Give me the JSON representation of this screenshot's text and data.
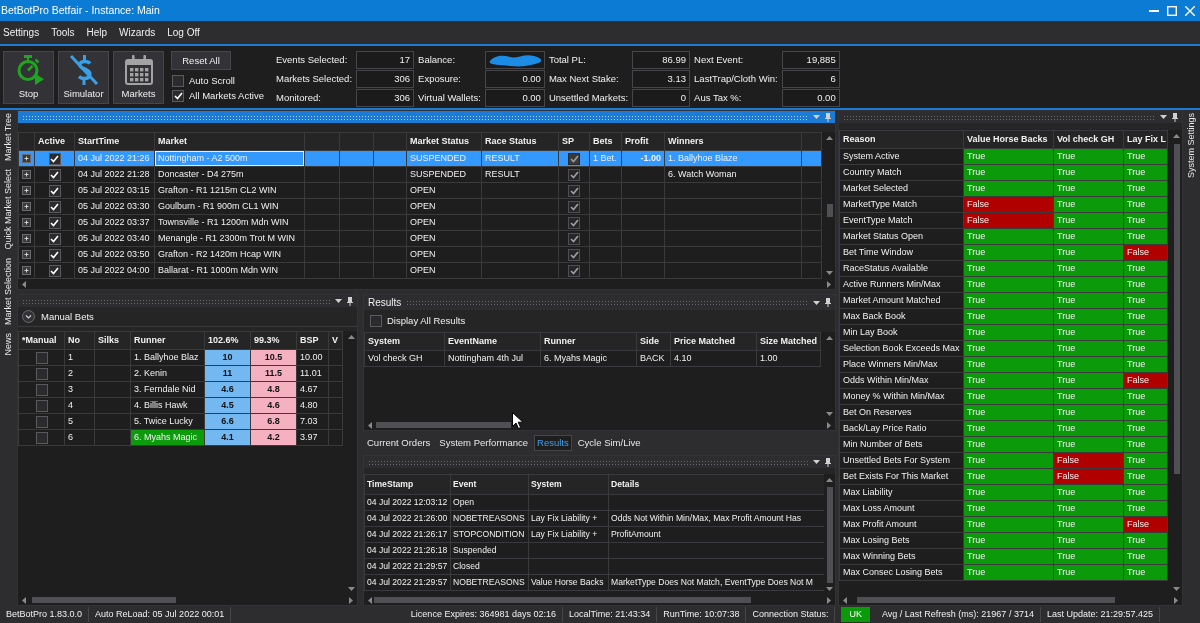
{
  "window": {
    "title": "BetBotPro Betfair - Instance: Main"
  },
  "menu": [
    "Settings",
    "Tools",
    "Help",
    "Wizards",
    "Log Off"
  ],
  "toolbar": {
    "buttons": [
      {
        "kind": "stop",
        "label": "Stop"
      },
      {
        "kind": "simulator",
        "label": "Simulator"
      },
      {
        "kind": "markets",
        "label": "Markets"
      }
    ],
    "reset_button": "Reset All",
    "options": [
      {
        "label": "Auto Scroll",
        "checked": false
      },
      {
        "label": "All Markets Active",
        "checked": true
      }
    ],
    "stats": [
      {
        "label": "Events Selected:",
        "value": "17",
        "redacted": false
      },
      {
        "label": "Balance:",
        "redacted": true
      },
      {
        "label": "Total PL:",
        "value": "86.99",
        "redacted": false
      },
      {
        "label": "Next Event:",
        "value": "19,885",
        "redacted": false
      },
      {
        "label": "Markets Selected:",
        "value": "306",
        "redacted": false
      },
      {
        "label": "Exposure:",
        "value": "0.00",
        "redacted": false
      },
      {
        "label": "Max Next Stake:",
        "value": "3.13",
        "redacted": false
      },
      {
        "label": "LastTrap/Cloth Win:",
        "value": "6",
        "redacted": false
      },
      {
        "label": "Monitored:",
        "value": "306",
        "redacted": false
      },
      {
        "label": "Virtual Wallets:",
        "value": "0.00",
        "redacted": false
      },
      {
        "label": "Unsettled Markets:",
        "value": "0",
        "redacted": false
      },
      {
        "label": "Aus Tax %:",
        "value": "0.00",
        "redacted": false
      }
    ]
  },
  "side_tabs": {
    "left": [
      "Market Tree",
      "Quick Market Select",
      "Market Selection",
      "News"
    ],
    "right": [
      "System Settings"
    ]
  },
  "markets": {
    "focused": true,
    "columns": [
      "Active",
      "StartTime",
      "Market",
      "Market Status",
      "Race Status",
      "SP",
      "Bets",
      "Profit",
      "Winners"
    ],
    "rows": [
      {
        "selected": true,
        "active": true,
        "start": "04 Jul 2022 21:26",
        "market": "Nottingham - A2 500m",
        "market_status": "SUSPENDED",
        "race_status": "RESULT",
        "sp": true,
        "bets": "1 Bet.",
        "profit": "-1.00",
        "winners": "1. Ballyhoe Blaze"
      },
      {
        "selected": false,
        "active": true,
        "start": "04 Jul 2022 21:28",
        "market": "Doncaster - D4 275m",
        "market_status": "SUSPENDED",
        "race_status": "RESULT",
        "sp": true,
        "winners": "6. Watch Woman"
      },
      {
        "selected": false,
        "active": true,
        "start": "05 Jul 2022 03:15",
        "market": "Grafton - R1 1215m CL2 WIN",
        "market_status": "OPEN",
        "sp": true
      },
      {
        "selected": false,
        "active": true,
        "start": "05 Jul 2022 03:30",
        "market": "Goulburn - R1 900m CL1 WIN",
        "market_status": "OPEN",
        "sp": true
      },
      {
        "selected": false,
        "active": true,
        "start": "05 Jul 2022 03:37",
        "market": "Townsville - R1 1200m Mdn WIN",
        "market_status": "OPEN",
        "sp": true
      },
      {
        "selected": false,
        "active": true,
        "start": "05 Jul 2022 03:40",
        "market": "Menangle - R1 2300m Trot M WIN",
        "market_status": "OPEN",
        "sp": true
      },
      {
        "selected": false,
        "active": true,
        "start": "05 Jul 2022 03:50",
        "market": "Grafton - R2 1420m Hcap WIN",
        "market_status": "OPEN",
        "sp": true
      },
      {
        "selected": false,
        "active": true,
        "start": "05 Jul 2022 04:00",
        "market": "Ballarat - R1 1000m Mdn WIN",
        "market_status": "OPEN",
        "sp": true
      }
    ]
  },
  "manual_bets": {
    "focused": false,
    "title": "Manual Bets",
    "columns": [
      "*Manual",
      "No",
      "Silks",
      "Runner",
      "102.6%",
      "99.3%",
      "BSP",
      "V"
    ],
    "runners": [
      {
        "manual": false,
        "no": "1",
        "runner": "1. Ballyhoe Blaz",
        "back": "10",
        "lay": "10.5",
        "bsp": "10.00",
        "matched": false
      },
      {
        "manual": false,
        "no": "2",
        "runner": "2. Kenin",
        "back": "11",
        "lay": "11.5",
        "bsp": "11.01",
        "matched": false
      },
      {
        "manual": false,
        "no": "3",
        "runner": "3. Ferndale Nid",
        "back": "4.6",
        "lay": "4.8",
        "bsp": "4.67",
        "matched": false
      },
      {
        "manual": false,
        "no": "4",
        "runner": "4. Billis Hawk",
        "back": "4.5",
        "lay": "4.6",
        "bsp": "4.80",
        "matched": false
      },
      {
        "manual": false,
        "no": "5",
        "runner": "5. Twice Lucky",
        "back": "6.6",
        "lay": "6.8",
        "bsp": "7.03",
        "matched": false
      },
      {
        "manual": false,
        "no": "6",
        "runner": "6. Myahs Magic",
        "back": "4.1",
        "lay": "4.2",
        "bsp": "3.97",
        "matched": true
      }
    ]
  },
  "results": {
    "focused": false,
    "title": "Results",
    "display_all": {
      "label": "Display All Results",
      "checked": false
    },
    "columns": [
      "System",
      "EventName",
      "Runner",
      "Side",
      "Price Matched",
      "Size Matched"
    ],
    "rows": [
      [
        "Vol check GH",
        "Nottingham 4th Jul",
        "6. Myahs Magic",
        "BACK",
        "4.10",
        "1.00"
      ]
    ]
  },
  "tabs": [
    {
      "label": "Current Orders",
      "selected": false
    },
    {
      "label": "System Performance",
      "selected": false
    },
    {
      "label": "Results",
      "selected": true
    },
    {
      "label": "Cycle Sim/Live",
      "selected": false
    }
  ],
  "log": {
    "focused": false,
    "columns": [
      "TimeStamp",
      "Event",
      "System",
      "Details"
    ],
    "rows": [
      [
        "04 Jul 2022 12:03:12",
        "Open"
      ],
      [
        "04 Jul 2022 21:26:00",
        "NOBETREASONS",
        "Lay Fix Liability +",
        "Odds Not Within Min/Max, Max Profit Amount Has"
      ],
      [
        "04 Jul 2022 21:26:17",
        "STOPCONDITION",
        "Lay Fix Liability +",
        "ProfitAmount"
      ],
      [
        "04 Jul 2022 21:26:18",
        "Suspended"
      ],
      [
        "04 Jul 2022 21:29:57",
        "Closed"
      ],
      [
        "04 Jul 2022 21:29:57",
        "NOBETREASONS",
        "Value Horse Backs",
        "MarketType Does Not Match, EventType Does Not M"
      ]
    ]
  },
  "reasons": {
    "focused": false,
    "columns": [
      "Reason",
      "Value Horse Backs",
      "Vol check GH",
      "Lay Fix L"
    ],
    "rows": [
      {
        "reason": "System Active",
        "checks": [
          {
            "text": "True",
            "ok": true
          },
          {
            "text": "True",
            "ok": true
          },
          {
            "text": "True",
            "ok": true
          }
        ]
      },
      {
        "reason": "Country Match",
        "checks": [
          {
            "text": "True",
            "ok": true
          },
          {
            "text": "True",
            "ok": true
          },
          {
            "text": "True",
            "ok": true
          }
        ]
      },
      {
        "reason": "Market Selected",
        "checks": [
          {
            "text": "True",
            "ok": true
          },
          {
            "text": "True",
            "ok": true
          },
          {
            "text": "True",
            "ok": true
          }
        ]
      },
      {
        "reason": "MarketType Match",
        "checks": [
          {
            "text": "False",
            "ok": false
          },
          {
            "text": "True",
            "ok": true
          },
          {
            "text": "True",
            "ok": true
          }
        ]
      },
      {
        "reason": "EventType Match",
        "checks": [
          {
            "text": "False",
            "ok": false
          },
          {
            "text": "True",
            "ok": true
          },
          {
            "text": "True",
            "ok": true
          }
        ]
      },
      {
        "reason": "Market Status Open",
        "checks": [
          {
            "text": "True",
            "ok": true
          },
          {
            "text": "True",
            "ok": true
          },
          {
            "text": "True",
            "ok": true
          }
        ]
      },
      {
        "reason": "Bet Time Window",
        "checks": [
          {
            "text": "True",
            "ok": true
          },
          {
            "text": "True",
            "ok": true
          },
          {
            "text": "False",
            "ok": false
          }
        ]
      },
      {
        "reason": "RaceStatus Available",
        "checks": [
          {
            "text": "True",
            "ok": true
          },
          {
            "text": "True",
            "ok": true
          },
          {
            "text": "True",
            "ok": true
          }
        ]
      },
      {
        "reason": "Active Runners Min/Max",
        "checks": [
          {
            "text": "True",
            "ok": true
          },
          {
            "text": "True",
            "ok": true
          },
          {
            "text": "True",
            "ok": true
          }
        ]
      },
      {
        "reason": "Market Amount Matched",
        "checks": [
          {
            "text": "True",
            "ok": true
          },
          {
            "text": "True",
            "ok": true
          },
          {
            "text": "True",
            "ok": true
          }
        ]
      },
      {
        "reason": "Max Back Book",
        "checks": [
          {
            "text": "True",
            "ok": true
          },
          {
            "text": "True",
            "ok": true
          },
          {
            "text": "True",
            "ok": true
          }
        ]
      },
      {
        "reason": "Min Lay Book",
        "checks": [
          {
            "text": "True",
            "ok": true
          },
          {
            "text": "True",
            "ok": true
          },
          {
            "text": "True",
            "ok": true
          }
        ]
      },
      {
        "reason": "Selection Book Exceeds Max",
        "checks": [
          {
            "text": "True",
            "ok": true
          },
          {
            "text": "True",
            "ok": true
          },
          {
            "text": "True",
            "ok": true
          }
        ]
      },
      {
        "reason": "Place Winners Min/Max",
        "checks": [
          {
            "text": "True",
            "ok": true
          },
          {
            "text": "True",
            "ok": true
          },
          {
            "text": "True",
            "ok": true
          }
        ]
      },
      {
        "reason": "Odds Within Min/Max",
        "checks": [
          {
            "text": "True",
            "ok": true
          },
          {
            "text": "True",
            "ok": true
          },
          {
            "text": "False",
            "ok": false
          }
        ]
      },
      {
        "reason": "Money % Within Min/Max",
        "checks": [
          {
            "text": "True",
            "ok": true
          },
          {
            "text": "True",
            "ok": true
          },
          {
            "text": "True",
            "ok": true
          }
        ]
      },
      {
        "reason": "Bet On Reserves",
        "checks": [
          {
            "text": "True",
            "ok": true
          },
          {
            "text": "True",
            "ok": true
          },
          {
            "text": "True",
            "ok": true
          }
        ]
      },
      {
        "reason": "Back/Lay Price Ratio",
        "checks": [
          {
            "text": "True",
            "ok": true
          },
          {
            "text": "True",
            "ok": true
          },
          {
            "text": "True",
            "ok": true
          }
        ]
      },
      {
        "reason": "Min Number of Bets",
        "checks": [
          {
            "text": "True",
            "ok": true
          },
          {
            "text": "True",
            "ok": true
          },
          {
            "text": "True",
            "ok": true
          }
        ]
      },
      {
        "reason": "Unsettled Bets For System",
        "checks": [
          {
            "text": "True",
            "ok": true
          },
          {
            "text": "False",
            "ok": false
          },
          {
            "text": "True",
            "ok": true
          }
        ]
      },
      {
        "reason": "Bet Exists For This Market",
        "checks": [
          {
            "text": "True",
            "ok": true
          },
          {
            "text": "False",
            "ok": false
          },
          {
            "text": "True",
            "ok": true
          }
        ]
      },
      {
        "reason": "Max Liability",
        "checks": [
          {
            "text": "True",
            "ok": true
          },
          {
            "text": "True",
            "ok": true
          },
          {
            "text": "True",
            "ok": true
          }
        ]
      },
      {
        "reason": "Max Loss Amount",
        "checks": [
          {
            "text": "True",
            "ok": true
          },
          {
            "text": "True",
            "ok": true
          },
          {
            "text": "True",
            "ok": true
          }
        ]
      },
      {
        "reason": "Max Profit Amount",
        "checks": [
          {
            "text": "True",
            "ok": true
          },
          {
            "text": "True",
            "ok": true
          },
          {
            "text": "False",
            "ok": false
          }
        ]
      },
      {
        "reason": "Max Losing Bets",
        "checks": [
          {
            "text": "True",
            "ok": true
          },
          {
            "text": "True",
            "ok": true
          },
          {
            "text": "True",
            "ok": true
          }
        ]
      },
      {
        "reason": "Max Winning Bets",
        "checks": [
          {
            "text": "True",
            "ok": true
          },
          {
            "text": "True",
            "ok": true
          },
          {
            "text": "True",
            "ok": true
          }
        ]
      },
      {
        "reason": "Max Consec Losing Bets",
        "checks": [
          {
            "text": "True",
            "ok": true
          },
          {
            "text": "True",
            "ok": true
          },
          {
            "text": "True",
            "ok": true
          }
        ]
      }
    ]
  },
  "status_bar": {
    "left": [
      {
        "kind": "text",
        "text": "BetBotPro 1.83.0.0"
      },
      {
        "kind": "text",
        "text": "Auto ReLoad: 05 Jul 2022 00:01"
      }
    ],
    "right": [
      {
        "kind": "text",
        "text": "Licence Expires: 364981 days 02:16"
      },
      {
        "kind": "text",
        "text": "LocalTime: 21:43:34"
      },
      {
        "kind": "text",
        "text": "RunTime: 10:07:38"
      },
      {
        "kind": "text",
        "text": "Connection Status:"
      },
      {
        "kind": "badge",
        "text": "UK"
      },
      {
        "kind": "text",
        "text": "Avg / Last Refresh (ms): 21967 / 3714"
      },
      {
        "kind": "text",
        "text": "Last Update: 21:29:57.425"
      }
    ]
  }
}
